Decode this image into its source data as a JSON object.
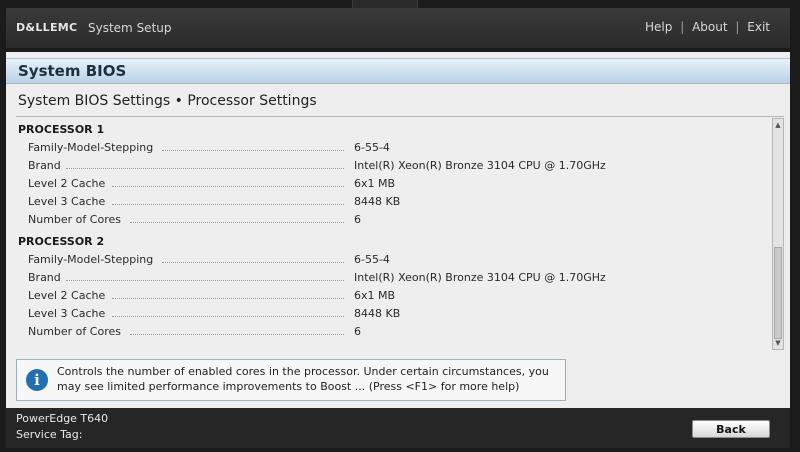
{
  "header": {
    "brand": "D&LLEMC",
    "app_title": "System Setup",
    "links": [
      "Help",
      "About",
      "Exit"
    ],
    "separator": "|"
  },
  "section": {
    "title": "System BIOS"
  },
  "breadcrumb": "System BIOS Settings • Processor Settings",
  "processors": [
    {
      "title": "PROCESSOR 1",
      "fields": [
        {
          "label": "Family-Model-Stepping",
          "value": "6-55-4"
        },
        {
          "label": "Brand",
          "value": "Intel(R) Xeon(R) Bronze 3104 CPU @ 1.70GHz"
        },
        {
          "label": "Level 2 Cache",
          "value": "6x1 MB"
        },
        {
          "label": "Level 3 Cache",
          "value": "8448 KB"
        },
        {
          "label": "Number of Cores",
          "value": "6"
        }
      ]
    },
    {
      "title": "PROCESSOR 2",
      "fields": [
        {
          "label": "Family-Model-Stepping",
          "value": "6-55-4"
        },
        {
          "label": "Brand",
          "value": "Intel(R) Xeon(R) Bronze 3104 CPU @ 1.70GHz"
        },
        {
          "label": "Level 2 Cache",
          "value": "6x1 MB"
        },
        {
          "label": "Level 3 Cache",
          "value": "8448 KB"
        },
        {
          "label": "Number of Cores",
          "value": "6"
        }
      ]
    }
  ],
  "help": {
    "icon": "info-icon",
    "line1": "Controls the number of enabled cores in the processor. Under certain circumstances, you",
    "line2": "may see limited performance improvements to Boost ... (Press <F1> for more help)"
  },
  "footer": {
    "model": "PowerEdge T640",
    "service_tag": "Service Tag: ",
    "back_label": "Back"
  },
  "colors": {
    "header_bar": "#2b2b2b",
    "section_header": "#b9d2e7",
    "content_bg": "#eeeeee",
    "info_icon": "#1f6fb5"
  }
}
